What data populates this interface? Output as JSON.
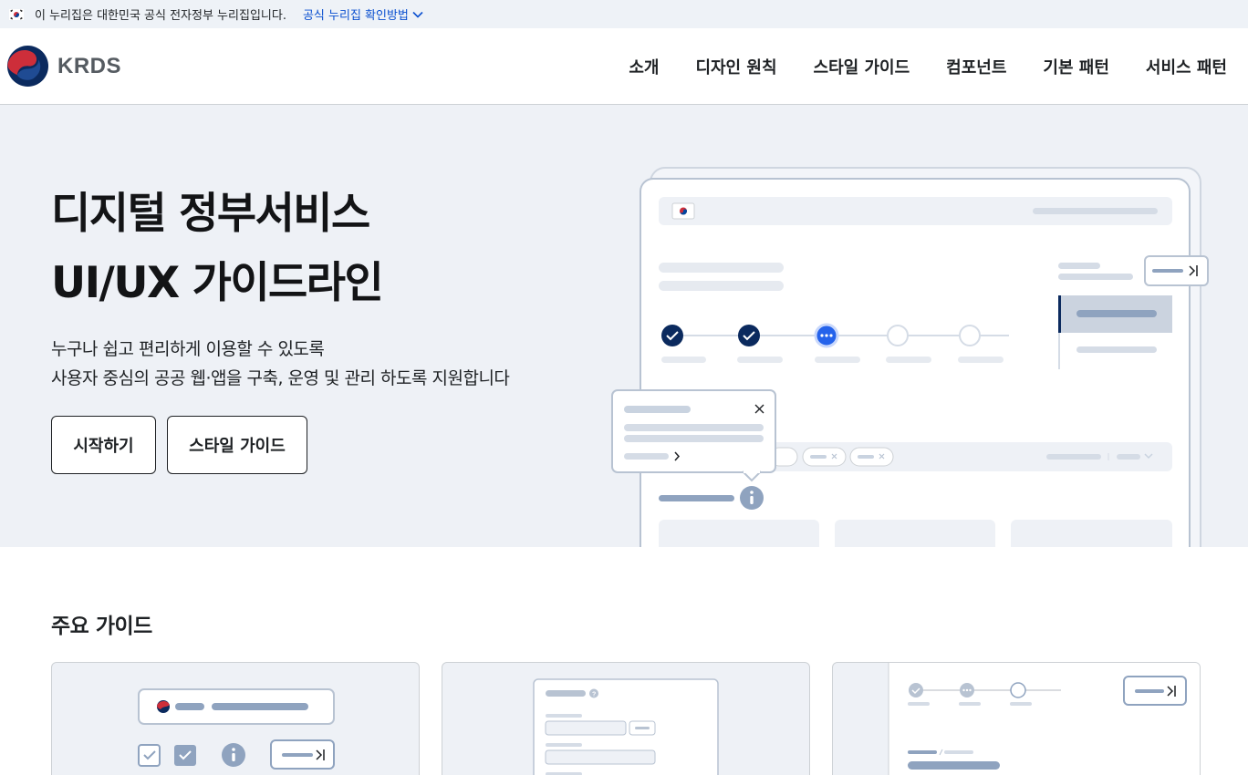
{
  "banner": {
    "message": "이 누리집은 대한민국 공식 전자정부 누리집입니다.",
    "link_label": "공식 누리집 확인방법"
  },
  "header": {
    "logo_text": "KRDS",
    "nav": [
      "소개",
      "디자인 원칙",
      "스타일 가이드",
      "컴포넌트",
      "기본 패턴",
      "서비스 패턴"
    ]
  },
  "hero": {
    "title_line1": "디지털 정부서비스",
    "title_line2": "UI/UX 가이드라인",
    "desc_line1": "누구나 쉽고 편리하게 이용할 수 있도록",
    "desc_line2": "사용자 중심의 공공 웹·앱을 구축, 운영 및 관리 하도록 지원합니다",
    "btn_start": "시작하기",
    "btn_style": "스타일 가이드"
  },
  "guides": {
    "title": "주요 가이드"
  },
  "colors": {
    "accent_navy": "#0b2a5e",
    "accent_blue": "#2563eb",
    "hero_bg": "#eef1f6",
    "placeholder": "#c9d3e0"
  }
}
